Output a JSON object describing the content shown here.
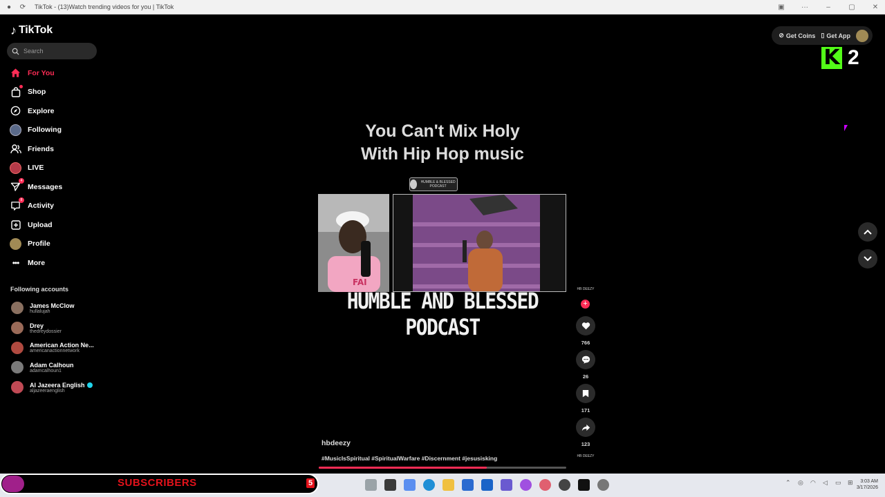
{
  "browser": {
    "tab_title": "TikTok - (13)Watch trending videos for you | TikTok"
  },
  "sidebar": {
    "logo": "TikTok",
    "search_placeholder": "Search",
    "nav": [
      {
        "label": "For You",
        "icon": "home-icon",
        "active": true
      },
      {
        "label": "Shop",
        "icon": "shopping-bag-icon"
      },
      {
        "label": "Explore",
        "icon": "compass-icon"
      },
      {
        "label": "Following",
        "icon": "following-avatar"
      },
      {
        "label": "Friends",
        "icon": "friends-icon"
      },
      {
        "label": "LIVE",
        "icon": "live-avatar"
      },
      {
        "label": "Messages",
        "icon": "send-icon",
        "badge": "4"
      },
      {
        "label": "Activity",
        "icon": "inbox-icon",
        "badge": "8"
      },
      {
        "label": "Upload",
        "icon": "plus-square-icon"
      },
      {
        "label": "Profile",
        "icon": "profile-avatar"
      },
      {
        "label": "More",
        "icon": "ellipsis-icon"
      }
    ],
    "following_title": "Following accounts",
    "following": [
      {
        "name": "James McClow",
        "username": "hullalujah",
        "color": "#8a7060"
      },
      {
        "name": "Drey",
        "username": "thedreydossier",
        "color": "#9a6a58"
      },
      {
        "name": "American Action Ne...",
        "username": "americanactionnetwork",
        "color": "#b04a40"
      },
      {
        "name": "Adam Calhoun",
        "username": "adamcalhoun1",
        "color": "#7a7a7a"
      },
      {
        "name": "Al Jazeera English",
        "username": "aljazeeraenglish",
        "color": "#c04a55",
        "verified": true
      }
    ]
  },
  "topbar": {
    "get_coins": "Get Coins",
    "get_app": "Get App",
    "kick_letter": "K",
    "kick_count": "2"
  },
  "video": {
    "title_line1": "You Can't Mix Holy",
    "title_line2": "With Hip Hop music",
    "podcast_logo_text": "HUMBLE & BLESSED PODCAST",
    "banner": "HUMBLE AND BLESSED PODCAST",
    "username": "hbdeezy",
    "hashtags": "#MusicIsSpiritual #SpiritualWarfare #Discernment #jesusisking",
    "progress": 0.68,
    "creator_tag": "HB DEEZY"
  },
  "actions": {
    "likes": "766",
    "comments": "26",
    "saves": "171",
    "shares": "123"
  },
  "overlay": {
    "subscribers_label": "SUBSCRIBERS",
    "subscribers_count": "5"
  },
  "system": {
    "time": "3:03 AM",
    "date": "3/17/2026"
  }
}
